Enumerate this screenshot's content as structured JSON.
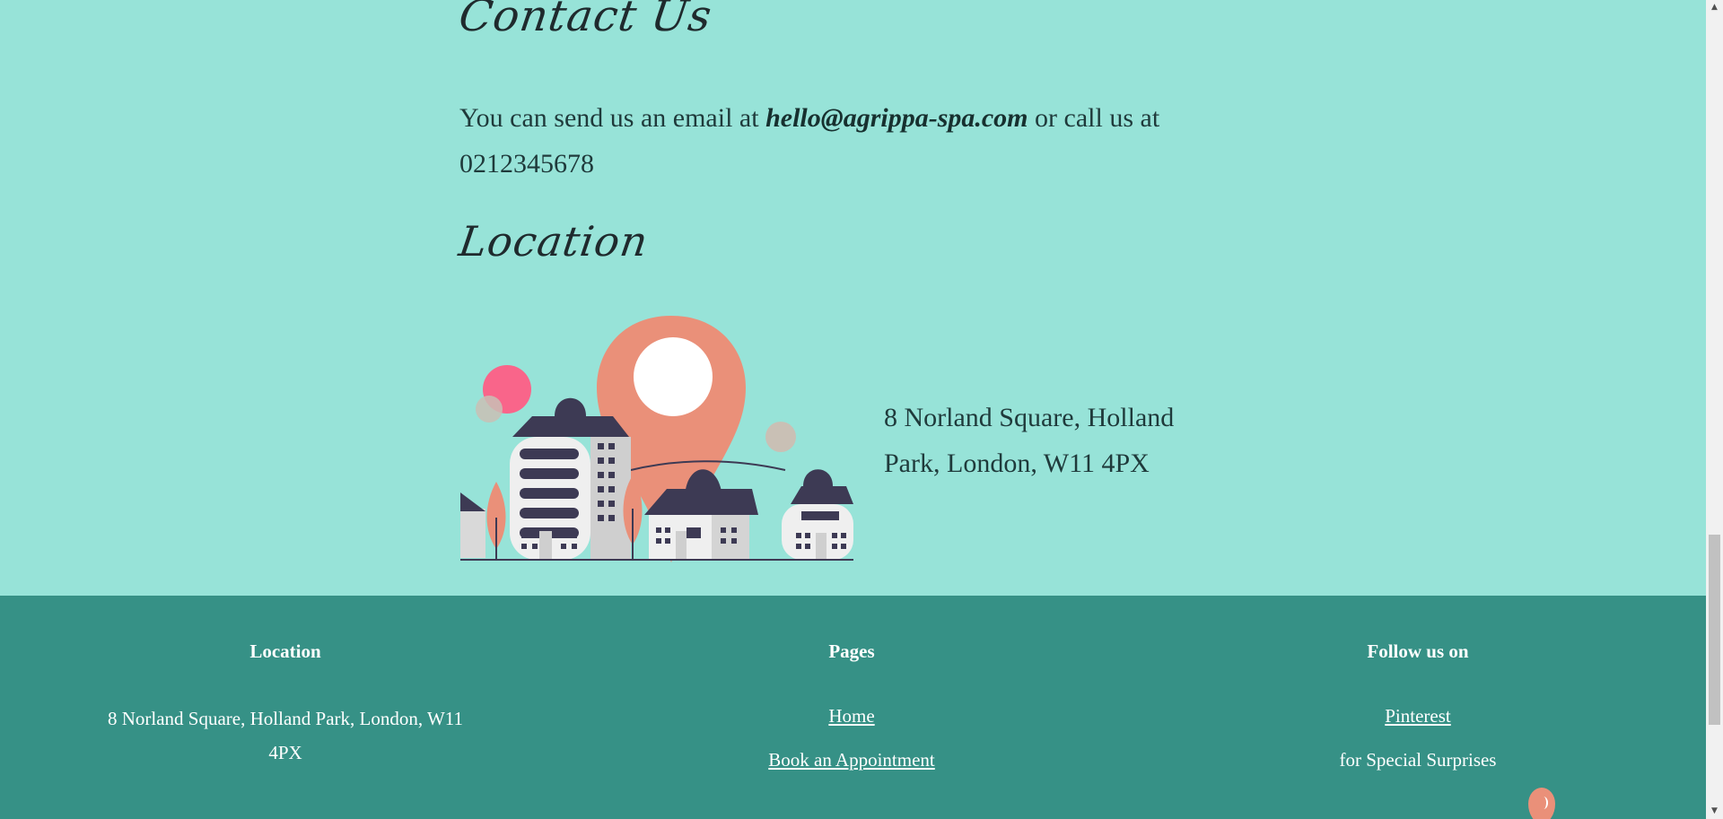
{
  "contact": {
    "heading": "Contact Us",
    "text_before": "You can send us an email at ",
    "email": "hello@agrippa-spa.com",
    "text_after": " or call us at 0212345678"
  },
  "location": {
    "heading": "Location",
    "illustration_icon": "city-location-pin-illustration",
    "address": "8 Norland Square, Holland Park, London, W11 4PX"
  },
  "footer": {
    "location": {
      "heading": "Location",
      "address": "8 Norland Square, Holland Park, London, W11 4PX"
    },
    "pages": {
      "heading": "Pages",
      "links": [
        "Home",
        "Book an Appointment"
      ]
    },
    "follow": {
      "heading": "Follow us on",
      "link": "Pinterest",
      "text": "for Special Surprises"
    }
  },
  "chat": {
    "icon": "chat-bubble-icon"
  },
  "colors": {
    "page_background": "#97e3d8",
    "footer_background": "#369186",
    "accent_coral": "#ea9079",
    "accent_pink": "#f9658a",
    "building_dark": "#3d3a54"
  }
}
